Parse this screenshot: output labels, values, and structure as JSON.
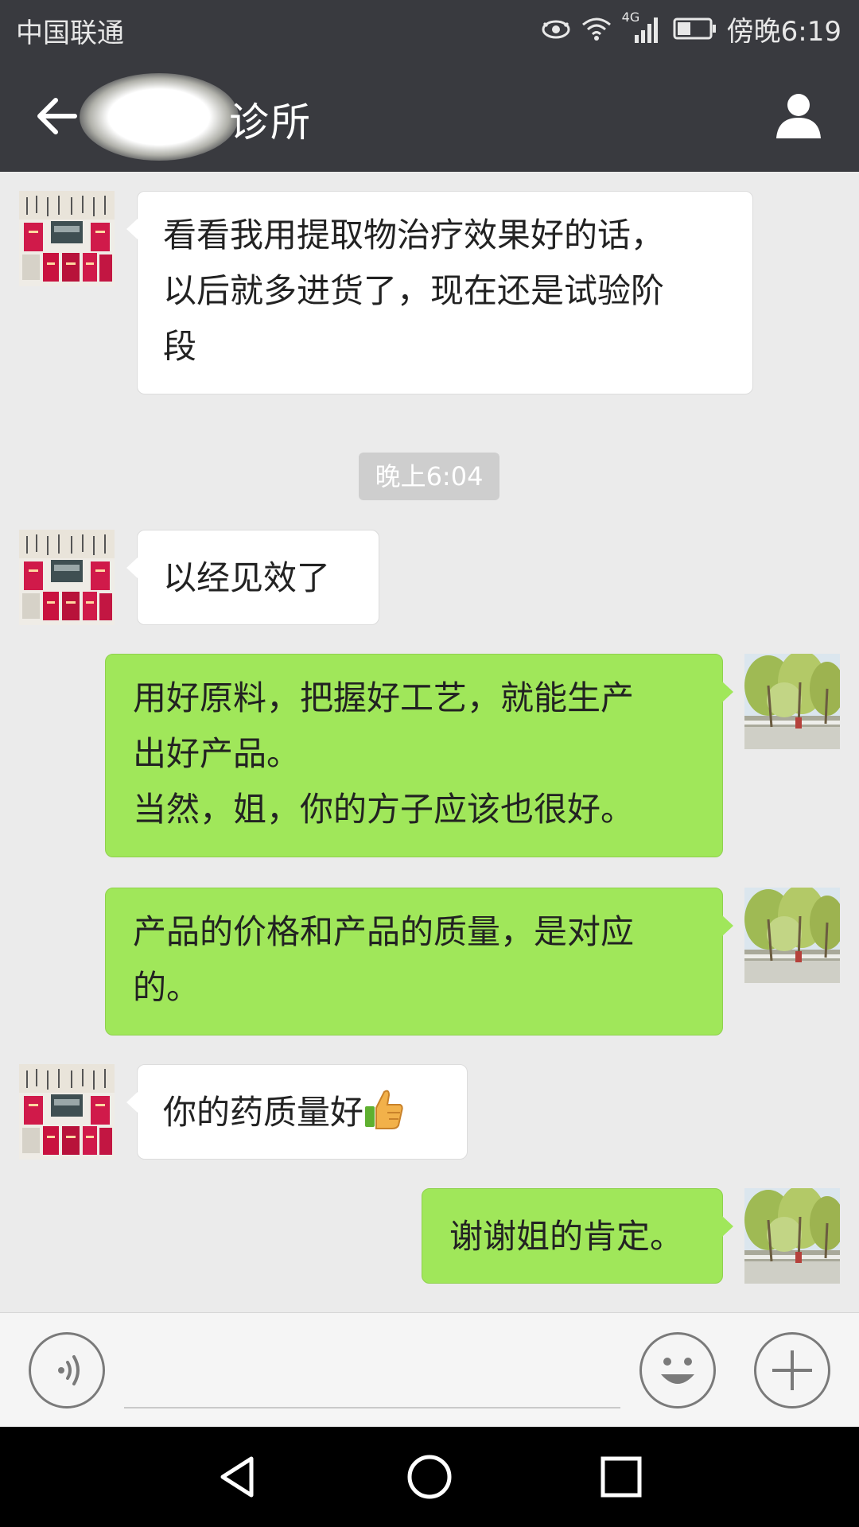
{
  "status_bar": {
    "carrier": "中国联通",
    "network": "4G",
    "time": "傍晚6:19"
  },
  "header": {
    "title": "诊所",
    "back_icon": "arrow-left-icon",
    "contact_icon": "person-icon"
  },
  "messages": [
    {
      "side": "in",
      "lines": [
        "看看我用提取物治疗效果好的话，",
        "以后就多进货了，现在还是试验阶",
        "段"
      ]
    },
    {
      "type": "timestamp",
      "text": "晚上6:04"
    },
    {
      "side": "in",
      "lines": [
        "以经见效了"
      ]
    },
    {
      "side": "out",
      "lines": [
        "用好原料，把握好工艺，就能生产",
        "出好产品。",
        "当然，姐，你的方子应该也很好。"
      ]
    },
    {
      "side": "out",
      "lines": [
        "产品的价格和产品的质量，是对应",
        "的。"
      ]
    },
    {
      "side": "in",
      "lines": [
        "你的药质量好"
      ],
      "emoji": "thumbs-up-icon"
    },
    {
      "side": "out",
      "lines": [
        "谢谢姐的肯定。"
      ]
    }
  ],
  "input_bar": {
    "voice_icon": "voice-icon",
    "emoji_icon": "smiley-icon",
    "more_icon": "plus-icon"
  },
  "nav_bar": {
    "back_icon": "triangle-back-icon",
    "home_icon": "circle-home-icon",
    "recents_icon": "square-recents-icon"
  },
  "colors": {
    "header_bg": "#393a3f",
    "chat_bg": "#ebebeb",
    "outgoing_bubble": "#a0e75a",
    "incoming_bubble": "#ffffff"
  }
}
